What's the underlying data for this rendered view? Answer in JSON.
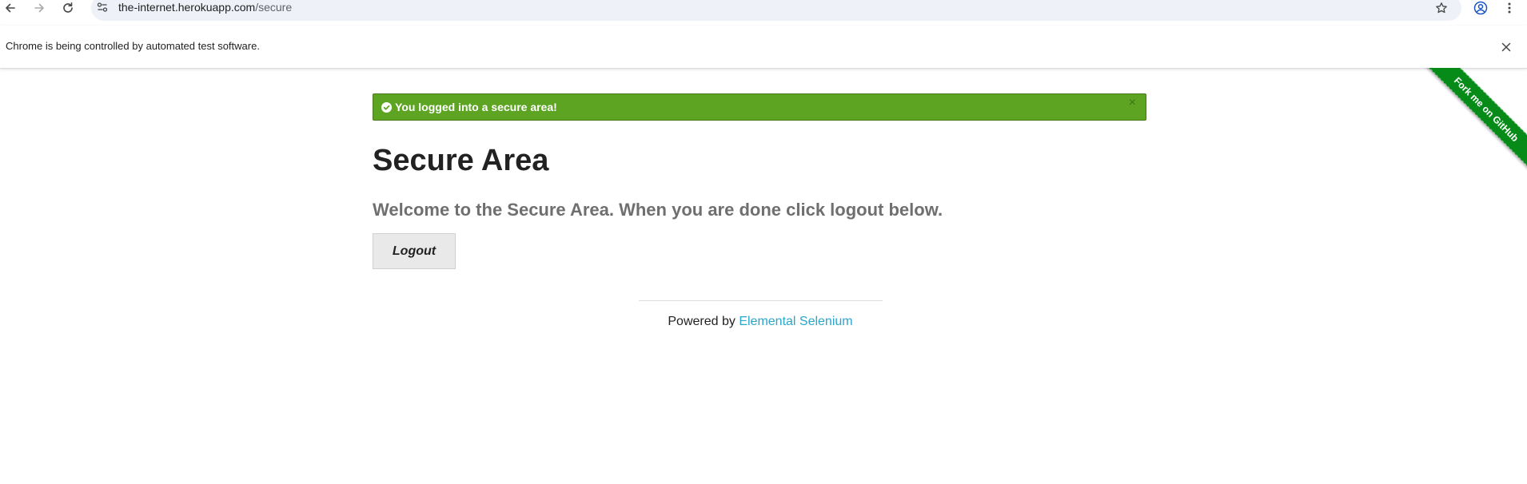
{
  "browser": {
    "url_host": "the-internet.herokuapp.com",
    "url_path": "/secure",
    "icons": {
      "back": "back-arrow-icon",
      "forward": "forward-arrow-icon",
      "reload": "reload-icon",
      "site_info": "site-info-icon",
      "bookmark": "star-icon",
      "profile": "profile-icon",
      "menu": "kebab-menu-icon"
    }
  },
  "infobar": {
    "message": "Chrome is being controlled by automated test software.",
    "close_symbol": "✕"
  },
  "flash": {
    "message": "You logged into a secure area!",
    "close_symbol": "×",
    "color": "#5da423",
    "icon": "check-circle-icon"
  },
  "page": {
    "title": "Secure Area",
    "subheader": "Welcome to the Secure Area. When you are done click logout below.",
    "logout_label": "Logout"
  },
  "footer": {
    "prefix": "Powered by ",
    "link_text": "Elemental Selenium",
    "link_color": "#2ba6cb"
  },
  "ribbon": {
    "text": "Fork me on GitHub",
    "color": "#078b18"
  }
}
